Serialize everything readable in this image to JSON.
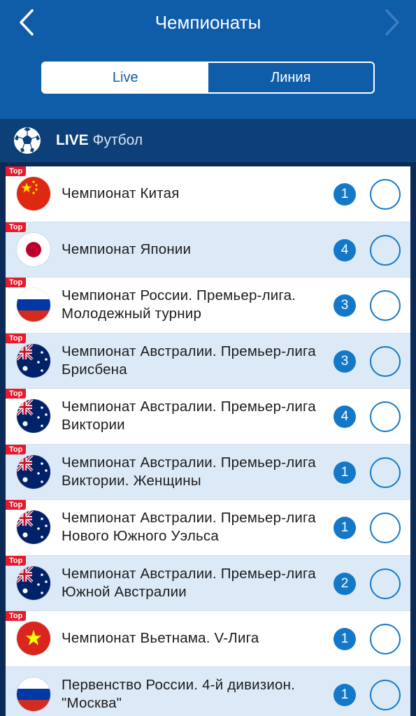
{
  "header": {
    "title": "Чемпионаты",
    "back_icon": "chevron-left-icon",
    "forward_icon": "chevron-right-icon"
  },
  "tabs": [
    {
      "label": "Live",
      "active": true
    },
    {
      "label": "Линия",
      "active": false
    }
  ],
  "section": {
    "icon": "soccer-ball-icon",
    "live_label": "LIVE",
    "sport_label": "Футбол"
  },
  "colors": {
    "header_bg": "#0f5ca8",
    "section_bg": "#0d3f78",
    "accent": "#1478c8",
    "top_badge": "#e31b2d",
    "row_alt": "#dceaf8"
  },
  "championships": [
    {
      "badge": "Top",
      "flag": "china-flag-icon",
      "name": "Чемпионат Китая",
      "count": "1"
    },
    {
      "badge": "Top",
      "flag": "japan-flag-icon",
      "name": "Чемпионат Японии",
      "count": "4"
    },
    {
      "badge": "Top",
      "flag": "russia-flag-icon",
      "name": "Чемпионат России. Премьер-лига. Молодежный турнир",
      "count": "3"
    },
    {
      "badge": "Top",
      "flag": "australia-flag-icon",
      "name": "Чемпионат Австралии. Премьер-лига Брисбена",
      "count": "3"
    },
    {
      "badge": "Top",
      "flag": "australia-flag-icon",
      "name": "Чемпионат Австралии. Премьер-лига Виктории",
      "count": "4"
    },
    {
      "badge": "Top",
      "flag": "australia-flag-icon",
      "name": "Чемпионат Австралии. Премьер-лига Виктории. Женщины",
      "count": "1"
    },
    {
      "badge": "Top",
      "flag": "australia-flag-icon",
      "name": "Чемпионат Австралии. Премьер-лига Нового Южного Уэльса",
      "count": "1"
    },
    {
      "badge": "Top",
      "flag": "australia-flag-icon",
      "name": "Чемпионат Австралии. Премьер-лига Южной Австралии",
      "count": "2"
    },
    {
      "badge": "Top",
      "flag": "vietnam-flag-icon",
      "name": "Чемпионат Вьетнама. V-Лига",
      "count": "1"
    },
    {
      "badge": "",
      "flag": "russia-flag-icon",
      "name": "Первенство России. 4-й дивизион. \"Москва\"",
      "count": "1"
    }
  ]
}
